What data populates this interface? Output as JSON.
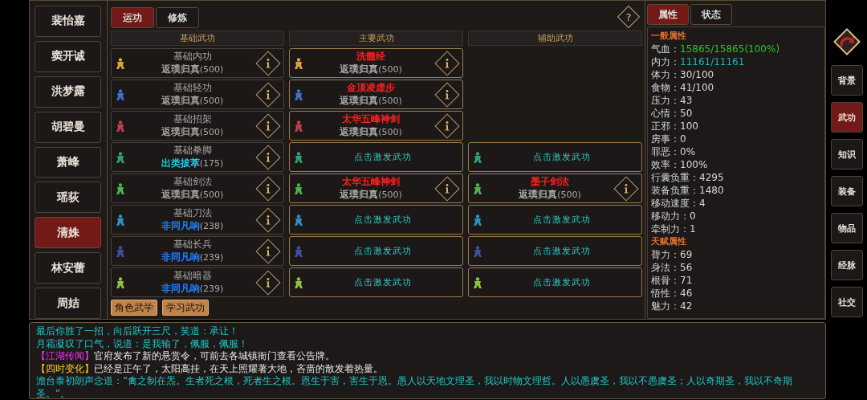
{
  "characters": [
    {
      "name": "裴怡嘉",
      "selected": false
    },
    {
      "name": "窦开诚",
      "selected": false
    },
    {
      "name": "洪梦露",
      "selected": false
    },
    {
      "name": "胡碧曼",
      "selected": false
    },
    {
      "name": "萧峰",
      "selected": false
    },
    {
      "name": "瑶荻",
      "selected": false
    },
    {
      "name": "清姝",
      "selected": true
    },
    {
      "name": "林安蕾",
      "selected": false
    },
    {
      "name": "周姞",
      "selected": false
    }
  ],
  "skill_panel": {
    "tabs": [
      {
        "label": "运功",
        "selected": true
      },
      {
        "label": "修炼",
        "selected": false
      }
    ],
    "help_glyph": "?",
    "columns": [
      "基础武功",
      "主要武功",
      "辅助武功"
    ],
    "rows": [
      {
        "color": "#e0a040",
        "base": {
          "name": "基础内功",
          "rank": {
            "label": "返璞归真",
            "color": "#a0a0a0"
          },
          "points": "(500)"
        },
        "main": {
          "kind": "skill",
          "name": "洗髓经",
          "rank": "返璞归真",
          "points": "(500)"
        }
      },
      {
        "color": "#4070c0",
        "base": {
          "name": "基础轻功",
          "rank": {
            "label": "返璞归真",
            "color": "#a0a0a0"
          },
          "points": "(500)"
        },
        "main": {
          "kind": "skill",
          "name": "金顶凌虚步",
          "rank": "返璞归真",
          "points": "(500)"
        }
      },
      {
        "color": "#c04050",
        "base": {
          "name": "基础招架",
          "rank": {
            "label": "返璞归真",
            "color": "#a0a0a0"
          },
          "points": "(500)"
        },
        "main": {
          "kind": "skill",
          "name": "太华五峰神剑",
          "rank": "返璞归真",
          "points": "(500)"
        }
      },
      {
        "color": "#30a070",
        "base": {
          "name": "基础拳脚",
          "rank": {
            "label": "出类拔萃",
            "color": "#20d0e0"
          },
          "points": "(175)"
        },
        "main": {
          "kind": "prompt",
          "text": "点击激发武功"
        },
        "aux": {
          "kind": "prompt",
          "text": "点击激发武功"
        }
      },
      {
        "color": "#50b050",
        "base": {
          "name": "基础剑法",
          "rank": {
            "label": "返璞归真",
            "color": "#a0a0a0"
          },
          "points": "(500)"
        },
        "main": {
          "kind": "skill",
          "name": "太华五峰神剑",
          "rank": "返璞归真",
          "points": "(500)"
        },
        "aux": {
          "kind": "skill",
          "name": "墨子剑法",
          "rank": "返璞归真",
          "points": "(500)"
        }
      },
      {
        "color": "#3090c0",
        "base": {
          "name": "基础刀法",
          "rank": {
            "label": "非同凡响",
            "color": "#2080ff"
          },
          "points": "(238)"
        },
        "main": {
          "kind": "prompt",
          "text": "点击激发武功"
        },
        "aux": {
          "kind": "prompt",
          "text": "点击激发武功"
        }
      },
      {
        "color": "#4050a0",
        "base": {
          "name": "基础长兵",
          "rank": {
            "label": "非同凡响",
            "color": "#2080ff"
          },
          "points": "(239)"
        },
        "main": {
          "kind": "prompt",
          "text": "点击激发武功"
        },
        "aux": {
          "kind": "prompt",
          "text": "点击激发武功"
        }
      },
      {
        "color": "#90c040",
        "base": {
          "name": "基础暗器",
          "rank": {
            "label": "非同凡响",
            "color": "#2080ff"
          },
          "points": "(239)"
        },
        "main": {
          "kind": "prompt",
          "text": "点击激发武功"
        },
        "aux": {
          "kind": "prompt",
          "text": "点击激发武功"
        }
      }
    ],
    "buttons": [
      "角色武学",
      "学习武功"
    ]
  },
  "stats_panel": {
    "tabs": [
      {
        "label": "属性",
        "selected": true
      },
      {
        "label": "状态",
        "selected": false
      }
    ],
    "sections": [
      {
        "title": "一般属性",
        "stats": [
          {
            "label": "气血：",
            "value": "15865/15865(100%)",
            "color": "#30c030"
          },
          {
            "label": "内力：",
            "value": "11161/11161",
            "color": "#20b0c0"
          },
          {
            "label": "体力：",
            "value": "30/100"
          },
          {
            "label": "食物：",
            "value": "41/100"
          },
          {
            "label": "压力：",
            "value": "43"
          },
          {
            "label": "心情：",
            "value": "50"
          },
          {
            "label": "正邪：",
            "value": "100"
          },
          {
            "label": "房事：",
            "value": "0"
          },
          {
            "label": "罪恶：",
            "value": "0%"
          },
          {
            "label": "效率：",
            "value": "100%"
          },
          {
            "label": "行囊负重：",
            "value": "4295"
          },
          {
            "label": "装备负重：",
            "value": "1480"
          },
          {
            "label": "移动速度：",
            "value": "4"
          },
          {
            "label": "移动力：",
            "value": "0"
          },
          {
            "label": "牵制力：",
            "value": "1"
          }
        ]
      },
      {
        "title": "天赋属性",
        "stats": [
          {
            "label": "膂力：",
            "value": "69"
          },
          {
            "label": "身法：",
            "value": "56"
          },
          {
            "label": "根骨：",
            "value": "71"
          },
          {
            "label": "悟性：",
            "value": "46"
          },
          {
            "label": "魅力：",
            "value": "42"
          }
        ]
      }
    ]
  },
  "side_nav": [
    {
      "label": "背景",
      "selected": false
    },
    {
      "label": "武功",
      "selected": true
    },
    {
      "label": "知识",
      "selected": false
    },
    {
      "label": "装备",
      "selected": false
    },
    {
      "label": "物品",
      "selected": false
    },
    {
      "label": "经脉",
      "selected": false
    },
    {
      "label": "社交",
      "selected": false
    }
  ],
  "log": [
    {
      "color": "#20c8c8",
      "text": "最后你胜了一招，向后跃开三尺，笑道：承让！"
    },
    {
      "color": "#20c8c8",
      "text": "月霜凝叹了口气，说道：是我输了，佩服，佩服！"
    },
    {
      "color": "#e8e8e8",
      "tag": {
        "label": "【江湖传闻】",
        "color": "#ff30ff"
      },
      "text": "官府发布了新的悬赏令，可前去各城镇衙门查看公告牌。"
    },
    {
      "color": "#e8e8e8",
      "tag": {
        "label": "【四时变化】",
        "color": "#ffd020"
      },
      "text": "已经是正午了，太阳高挂，在天上照耀著大地，吝啬的散发着热量。"
    },
    {
      "color": "#20c8c8",
      "text": "澹台泰初朗声念道：“禽之制在炁。生者死之根，死者生之根。恩生于害，害生于恩。愚人以天地文理圣，我以时物文理哲。人以愚虞圣，我以不愚虞圣；人以奇期圣，我以不奇期圣。”。"
    }
  ]
}
